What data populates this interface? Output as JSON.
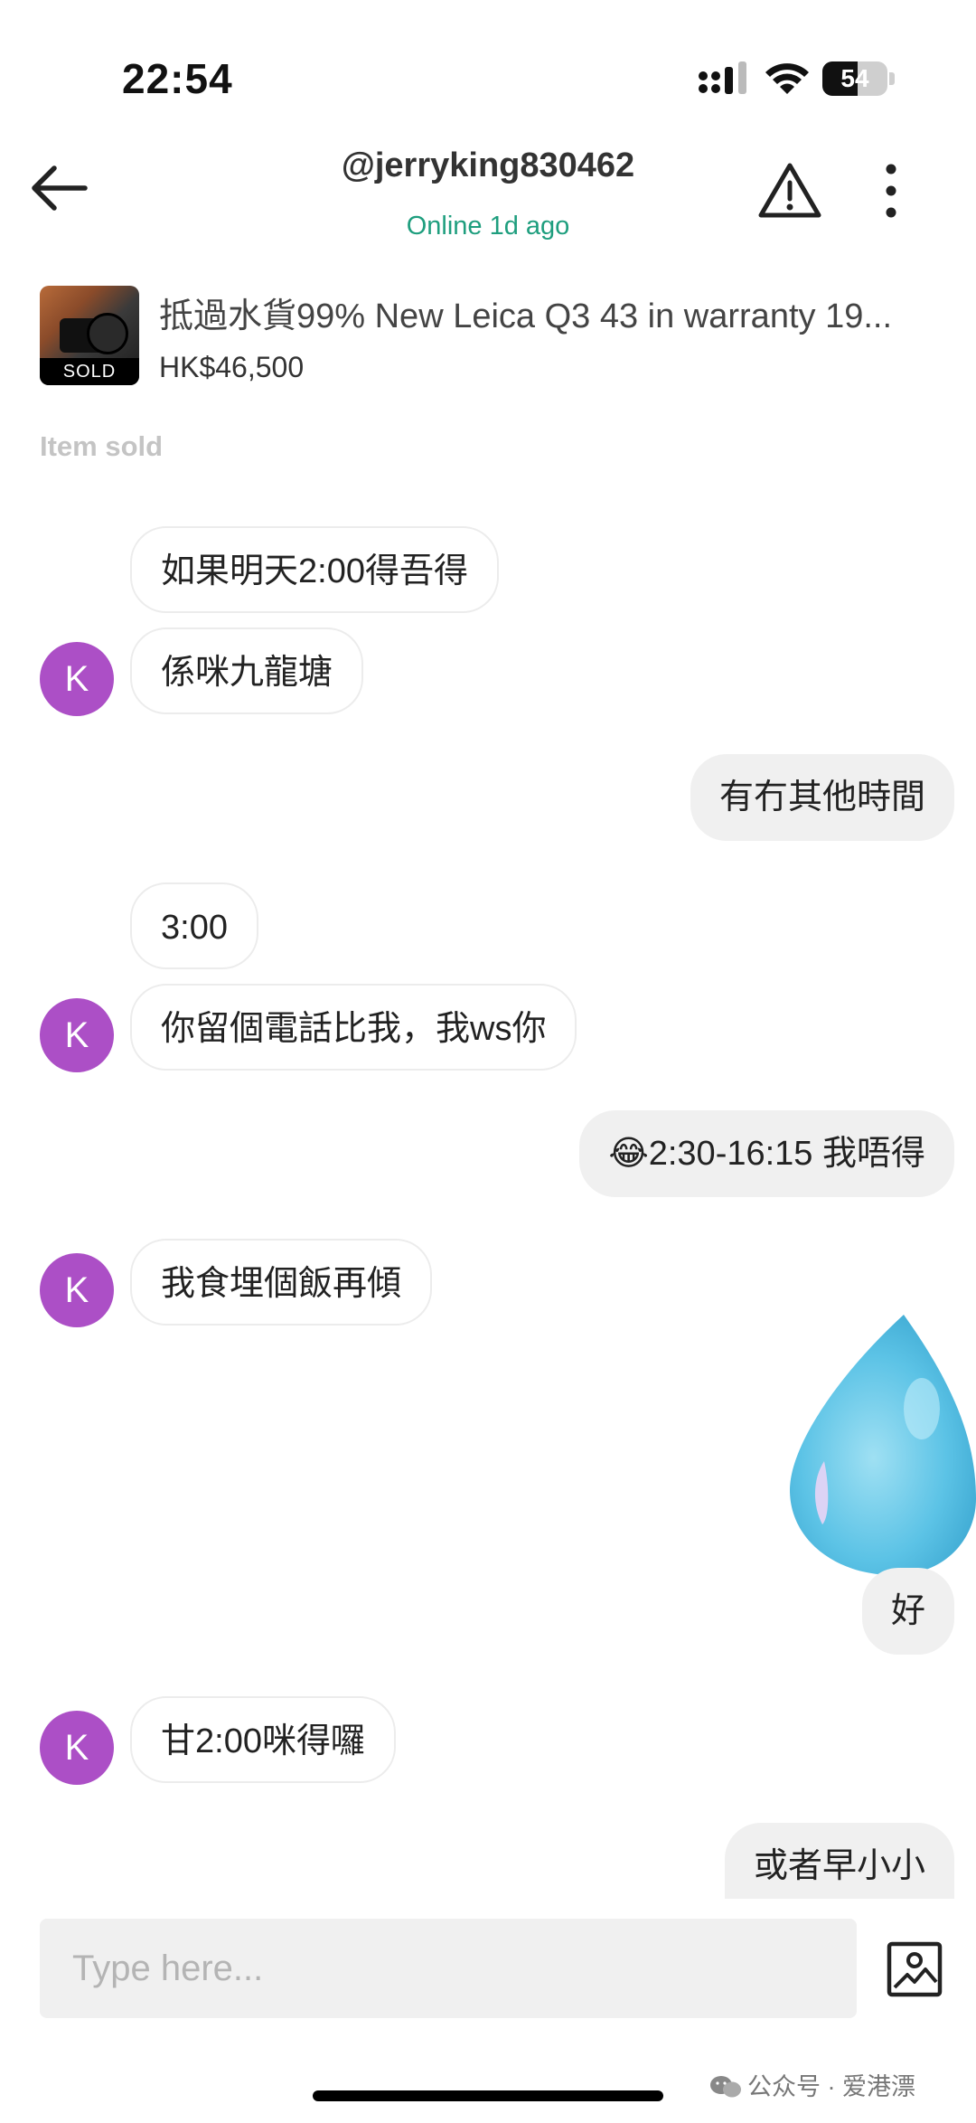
{
  "status_bar": {
    "time": "22:54",
    "battery_level": "54"
  },
  "header": {
    "username": "@jerryking830462",
    "online_status": "Online 1d ago"
  },
  "product": {
    "title": "抵過水貨99% New Leica Q3 43 in warranty 19...",
    "price": "HK$46,500",
    "badge": "SOLD",
    "status": "Item sold"
  },
  "contact": {
    "avatar_letter": "K"
  },
  "messages": [
    {
      "side": "in",
      "text": "如果明天2:00得吾得"
    },
    {
      "side": "in",
      "text": "係咪九龍塘"
    },
    {
      "side": "out",
      "text": "有冇其他時間"
    },
    {
      "side": "in",
      "text": "3:00"
    },
    {
      "side": "in",
      "text": "你留個電話比我，我ws你"
    },
    {
      "side": "out",
      "text": "😂2:30-16:15 我唔得"
    },
    {
      "side": "in",
      "text": "我食埋個飯再傾"
    },
    {
      "side": "out",
      "type": "sticker",
      "sticker": "water-drop-sticker"
    },
    {
      "side": "out",
      "text": "好"
    },
    {
      "side": "in",
      "text": "甘2:00咪得囉"
    },
    {
      "side": "out",
      "text": "或者早小小"
    }
  ],
  "composer": {
    "placeholder": "Type here..."
  },
  "watermark": {
    "text": "公众号 · 爱港漂"
  },
  "colors": {
    "avatar": "#ac4fc6",
    "online": "#1e9e7e",
    "outgoing_bubble": "#f0f0f0"
  }
}
